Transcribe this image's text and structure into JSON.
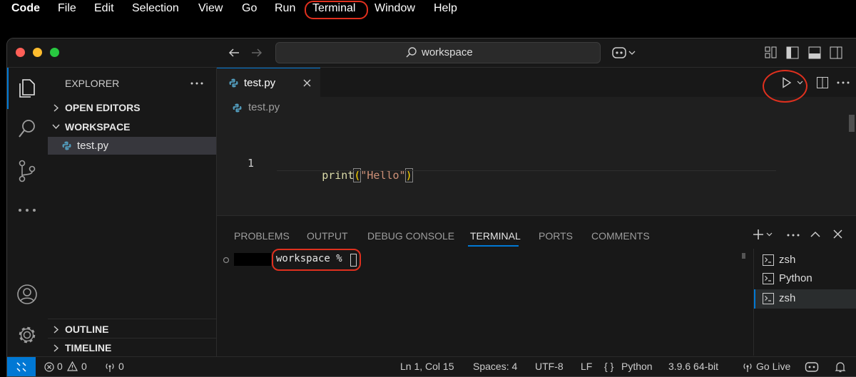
{
  "menubar": {
    "app": "Code",
    "items": [
      "File",
      "Edit",
      "Selection",
      "View",
      "Go",
      "Run",
      "Terminal",
      "Window",
      "Help"
    ]
  },
  "titlebar": {
    "search_text": "workspace"
  },
  "sidebar": {
    "title": "EXPLORER",
    "open_editors": "OPEN EDITORS",
    "workspace": "WORKSPACE",
    "file": "test.py",
    "outline": "OUTLINE",
    "timeline": "TIMELINE"
  },
  "editor": {
    "tab_label": "test.py",
    "breadcrumb": "test.py",
    "line_number": "1",
    "code": {
      "fn": "print",
      "open": "(",
      "str": "\"Hello\"",
      "close": ")"
    }
  },
  "panel": {
    "tabs": [
      "PROBLEMS",
      "OUTPUT",
      "DEBUG CONSOLE",
      "TERMINAL",
      "PORTS",
      "COMMENTS"
    ],
    "active_tab": "TERMINAL",
    "prompt": "workspace %",
    "terminals": [
      "zsh",
      "Python",
      "zsh"
    ]
  },
  "statusbar": {
    "errors": "0",
    "warnings": "0",
    "ports": "0",
    "position": "Ln 1, Col 15",
    "spaces": "Spaces: 4",
    "encoding": "UTF-8",
    "eol": "LF",
    "language": "Python",
    "interpreter": "3.9.6 64-bit",
    "golive": "Go Live"
  },
  "colors": {
    "accent": "#0078d4",
    "annotation": "#e0301e",
    "string": "#ce9178",
    "function": "#dcdcaa",
    "bracket": "#ffd700"
  }
}
